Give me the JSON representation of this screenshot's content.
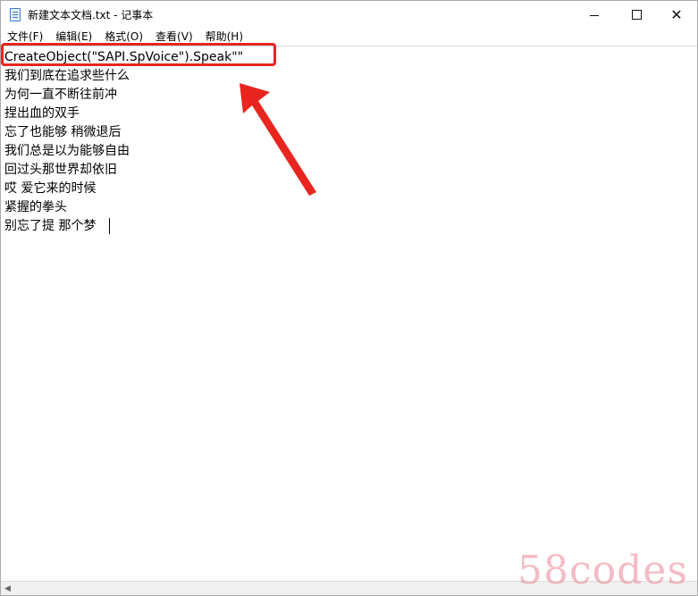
{
  "window": {
    "title": "新建文本文档.txt - 记事本"
  },
  "menu": {
    "items": [
      "文件(F)",
      "编辑(E)",
      "格式(O)",
      "查看(V)",
      "帮助(H)"
    ]
  },
  "editor": {
    "lines": [
      "CreateObject(\"SAPI.SpVoice\").Speak\"\"",
      "我们到底在追求些什么",
      "为何一直不断往前冲",
      "捏出血的双手",
      "忘了也能够 稍微退后",
      "我们总是以为能够自由",
      "回过头那世界却依旧",
      "哎 爱它来的时候",
      "紧握的拳头",
      "别忘了提 那个梦"
    ]
  },
  "annotation": {
    "color": "#e8261f"
  },
  "watermark": {
    "text": "58codes"
  },
  "icons": {
    "app": "notepad-icon",
    "minimize": "minimize-icon",
    "maximize": "maximize-icon",
    "close": "close-icon"
  }
}
